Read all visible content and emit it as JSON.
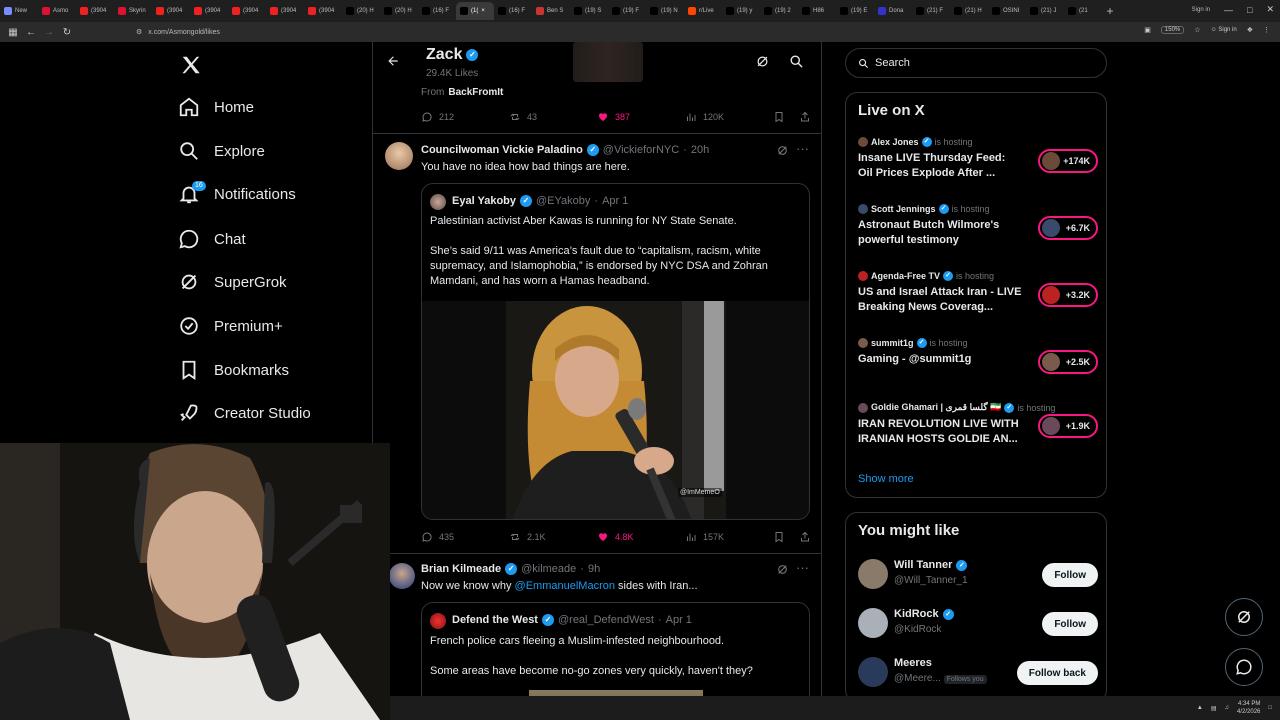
{
  "browser": {
    "tabs": [
      {
        "label": "New",
        "fav": "#7b8cff",
        "active": false
      },
      {
        "label": "Asmo",
        "fav": "#d13",
        "active": false
      },
      {
        "label": "(3904",
        "fav": "#e22",
        "active": false
      },
      {
        "label": "Skyrin",
        "fav": "#d13",
        "active": false
      },
      {
        "label": "(3904",
        "fav": "#e22",
        "active": false
      },
      {
        "label": "(3904",
        "fav": "#e22",
        "active": false
      },
      {
        "label": "(3904",
        "fav": "#e22",
        "active": false
      },
      {
        "label": "(3904",
        "fav": "#e22",
        "active": false
      },
      {
        "label": "(3904",
        "fav": "#e22",
        "active": false
      },
      {
        "label": "(20) H",
        "fav": "#000",
        "active": false
      },
      {
        "label": "(20) H",
        "fav": "#000",
        "active": false
      },
      {
        "label": "(16) F",
        "fav": "#000",
        "active": false
      },
      {
        "label": "(1(",
        "fav": "#000",
        "active": true
      },
      {
        "label": "(16) F",
        "fav": "#000",
        "active": false
      },
      {
        "label": "Ben S",
        "fav": "#c33",
        "active": false
      },
      {
        "label": "(19) S",
        "fav": "#000",
        "active": false
      },
      {
        "label": "(19) F",
        "fav": "#000",
        "active": false
      },
      {
        "label": "(19) N",
        "fav": "#000",
        "active": false
      },
      {
        "label": "r/Live",
        "fav": "#ff4500",
        "active": false
      },
      {
        "label": "(19) y",
        "fav": "#000",
        "active": false
      },
      {
        "label": "(19) 2",
        "fav": "#000",
        "active": false
      },
      {
        "label": "H86",
        "fav": "#000",
        "active": false
      },
      {
        "label": "(19) E",
        "fav": "#000",
        "active": false
      },
      {
        "label": "Dona",
        "fav": "#33c",
        "active": false
      },
      {
        "label": "(21) F",
        "fav": "#000",
        "active": false
      },
      {
        "label": "(21) H",
        "fav": "#000",
        "active": false
      },
      {
        "label": "OSINI",
        "fav": "#000",
        "active": false
      },
      {
        "label": "(21) J",
        "fav": "#000",
        "active": false
      },
      {
        "label": "(21",
        "fav": "#000",
        "active": false
      }
    ],
    "new_tab": "+",
    "sign_in": "Sign in",
    "url": "x.com/Asmongold/likes",
    "zoom": "150%"
  },
  "nav": {
    "items": [
      {
        "label": "Home",
        "icon": "home-icon"
      },
      {
        "label": "Explore",
        "icon": "search-icon"
      },
      {
        "label": "Notifications",
        "icon": "bell-icon",
        "badge": "16"
      },
      {
        "label": "Chat",
        "icon": "chat-icon"
      },
      {
        "label": "SuperGrok",
        "icon": "grok-icon"
      },
      {
        "label": "Premium+",
        "icon": "premium-icon"
      },
      {
        "label": "Bookmarks",
        "icon": "bookmark-icon"
      },
      {
        "label": "Creator Studio",
        "icon": "rocket-icon"
      }
    ]
  },
  "header": {
    "name": "Zack",
    "sub": "29.4K Likes",
    "from_label": "From",
    "from_source": "BackFromIt"
  },
  "tweet0": {
    "replies": "212",
    "reposts": "43",
    "likes": "387",
    "views": "120K"
  },
  "tweet1": {
    "name": "Councilwoman Vickie Paladino",
    "handle": "@VickieforNYC",
    "time": "20h",
    "text": "You have no idea how bad things are here.",
    "quote": {
      "name": "Eyal Yakoby",
      "handle": "@EYakoby",
      "time": "Apr 1",
      "text1": "Palestinian activist Aber Kawas is running for NY State Senate.",
      "text2": "She’s said 9/11 was America’s fault due to “capitalism, racism, white supremacy, and Islamophobia,” is endorsed by NYC DSA and Zohran Mamdani, and has worn a Hamas headband.",
      "watermark": "@ImMemeO"
    },
    "replies": "435",
    "reposts": "2.1K",
    "likes": "4.8K",
    "views": "157K"
  },
  "tweet2": {
    "name": "Brian Kilmeade",
    "handle": "@kilmeade",
    "time": "9h",
    "text_before": "Now we know why ",
    "mention": "@EmmanuelMacron",
    "text_after": " sides with Iran...",
    "quote": {
      "name": "Defend the West",
      "handle": "@real_DefendWest",
      "time": "Apr 1",
      "text1": "French police cars fleeing a Muslim-infested neighbourhood.",
      "text2": "Some areas have become no-go zones very quickly, haven't they?"
    }
  },
  "search": {
    "placeholder": "Search"
  },
  "live": {
    "title": "Live on X",
    "hosting": "is hosting",
    "items": [
      {
        "host": "Alex Jones",
        "title": "Insane LIVE Thursday Feed: Oil Prices Explode After ...",
        "count": "+174K",
        "verified": true
      },
      {
        "host": "Scott Jennings",
        "title": "Astronaut Butch Wilmore's powerful testimony",
        "count": "+6.7K",
        "verified": true
      },
      {
        "host": "Agenda-Free TV",
        "title": "US and Israel Attack Iran - LIVE Breaking News Coverag...",
        "count": "+3.2K",
        "verified": true
      },
      {
        "host": "summit1g",
        "title": "Gaming - @summit1g",
        "count": "+2.5K",
        "verified": true
      },
      {
        "host": "Goldie Ghamari | گلسا قمری 🇮🇷",
        "title": "IRAN REVOLUTION LIVE WITH IRANIAN HOSTS GOLDIE AN...",
        "count": "+1.9K",
        "verified": true
      }
    ],
    "show_more": "Show more"
  },
  "wtf": {
    "title": "You might like",
    "items": [
      {
        "name": "Will Tanner",
        "handle": "@Will_Tanner_1",
        "button": "Follow",
        "follows_you": ""
      },
      {
        "name": "KidRock",
        "handle": "@KidRock",
        "button": "Follow",
        "follows_you": ""
      },
      {
        "name": "Meeres",
        "handle": "@Meere...",
        "button": "Follow back",
        "follows_you": "Follows you"
      }
    ]
  },
  "taskbar": {
    "time": "4:34 PM",
    "date": "4/2/2026"
  }
}
